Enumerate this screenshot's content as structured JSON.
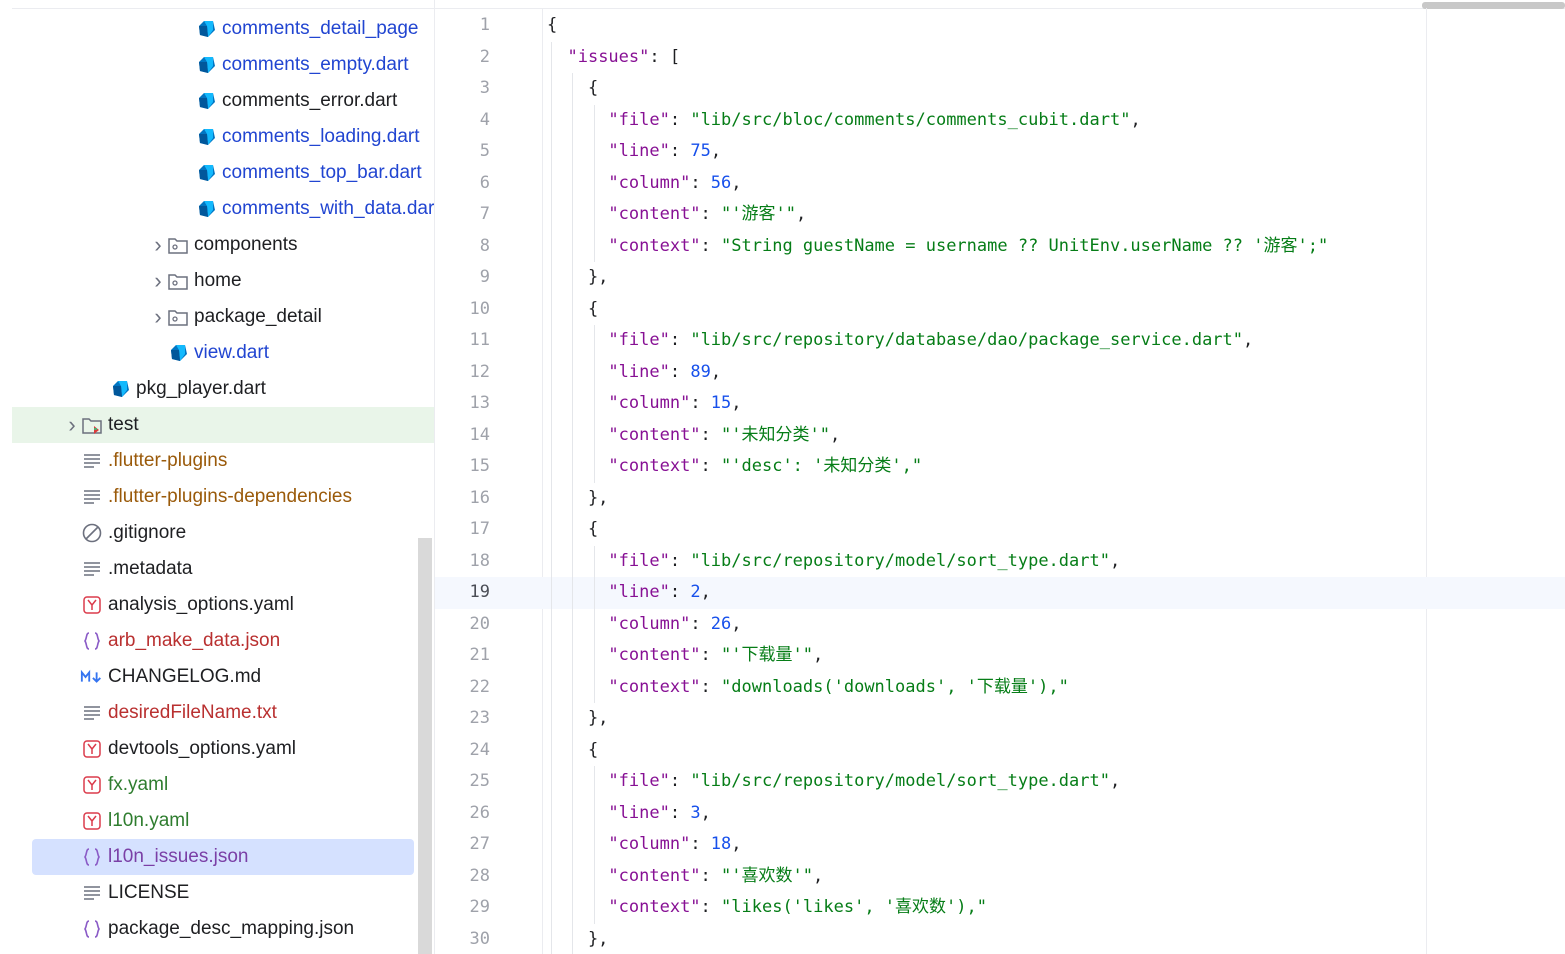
{
  "file_tree": [
    {
      "label": "comments_detail_page",
      "kind": "dart",
      "color": "blue",
      "indent": 208
    },
    {
      "label": "comments_empty.dart",
      "kind": "dart",
      "color": "blue",
      "indent": 208
    },
    {
      "label": "comments_error.dart",
      "kind": "dart",
      "color": "black",
      "indent": 208
    },
    {
      "label": "comments_loading.dart",
      "kind": "dart",
      "color": "blue",
      "indent": 208
    },
    {
      "label": "comments_top_bar.dart",
      "kind": "dart",
      "color": "blue",
      "indent": 208
    },
    {
      "label": "comments_with_data.dart",
      "kind": "dart",
      "color": "blue",
      "indent": 208
    },
    {
      "label": "components",
      "kind": "folder",
      "color": "black",
      "indent": 180,
      "expandable": true
    },
    {
      "label": "home",
      "kind": "folder",
      "color": "black",
      "indent": 180,
      "expandable": true
    },
    {
      "label": "package_detail",
      "kind": "folder",
      "color": "black",
      "indent": 180,
      "expandable": true
    },
    {
      "label": "view.dart",
      "kind": "dart",
      "color": "blue",
      "indent": 180
    },
    {
      "label": "pkg_player.dart",
      "kind": "dart",
      "color": "black",
      "indent": 122
    },
    {
      "label": "test",
      "kind": "test-folder",
      "color": "black",
      "indent": 94,
      "expandable": true,
      "active": true
    },
    {
      "label": ".flutter-plugins",
      "kind": "text",
      "color": "orange",
      "indent": 94
    },
    {
      "label": ".flutter-plugins-dependencies",
      "kind": "text",
      "color": "orange",
      "indent": 94
    },
    {
      "label": ".gitignore",
      "kind": "ignore",
      "color": "black",
      "indent": 94
    },
    {
      "label": ".metadata",
      "kind": "text",
      "color": "black",
      "indent": 94
    },
    {
      "label": "analysis_options.yaml",
      "kind": "yaml",
      "color": "black",
      "indent": 94
    },
    {
      "label": "arb_make_data.json",
      "kind": "json",
      "color": "red",
      "indent": 94
    },
    {
      "label": "CHANGELOG.md",
      "kind": "md",
      "color": "black",
      "indent": 94
    },
    {
      "label": "desiredFileName.txt",
      "kind": "text",
      "color": "red",
      "indent": 94
    },
    {
      "label": "devtools_options.yaml",
      "kind": "yaml",
      "color": "black",
      "indent": 94
    },
    {
      "label": "fx.yaml",
      "kind": "yaml",
      "color": "green",
      "indent": 94
    },
    {
      "label": "l10n.yaml",
      "kind": "yaml",
      "color": "green",
      "indent": 94
    },
    {
      "label": "l10n_issues.json",
      "kind": "json",
      "color": "purple",
      "indent": 94,
      "selected": true
    },
    {
      "label": "LICENSE",
      "kind": "text",
      "color": "black",
      "indent": 94
    },
    {
      "label": "package_desc_mapping.json",
      "kind": "json",
      "color": "black",
      "indent": 94
    }
  ],
  "editor": {
    "current_line": 19,
    "lines": [
      {
        "n": "1",
        "t": [
          [
            "p",
            "{"
          ]
        ]
      },
      {
        "n": "2",
        "t": [
          [
            "p",
            "  "
          ],
          [
            "k",
            "\"issues\""
          ],
          [
            "p",
            ": ["
          ]
        ]
      },
      {
        "n": "3",
        "t": [
          [
            "p",
            "    {"
          ]
        ]
      },
      {
        "n": "4",
        "t": [
          [
            "p",
            "      "
          ],
          [
            "k",
            "\"file\""
          ],
          [
            "p",
            ": "
          ],
          [
            "s",
            "\"lib/src/bloc/comments/comments_cubit.dart\""
          ],
          [
            "p",
            ","
          ]
        ]
      },
      {
        "n": "5",
        "t": [
          [
            "p",
            "      "
          ],
          [
            "k",
            "\"line\""
          ],
          [
            "p",
            ": "
          ],
          [
            "n",
            "75"
          ],
          [
            "p",
            ","
          ]
        ]
      },
      {
        "n": "6",
        "t": [
          [
            "p",
            "      "
          ],
          [
            "k",
            "\"column\""
          ],
          [
            "p",
            ": "
          ],
          [
            "n",
            "56"
          ],
          [
            "p",
            ","
          ]
        ]
      },
      {
        "n": "7",
        "t": [
          [
            "p",
            "      "
          ],
          [
            "k",
            "\"content\""
          ],
          [
            "p",
            ": "
          ],
          [
            "s",
            "\"'游客'\""
          ],
          [
            "p",
            ","
          ]
        ]
      },
      {
        "n": "8",
        "t": [
          [
            "p",
            "      "
          ],
          [
            "k",
            "\"context\""
          ],
          [
            "p",
            ": "
          ],
          [
            "s",
            "\"String guestName = username ?? UnitEnv.userName ?? '游客';\""
          ]
        ]
      },
      {
        "n": "9",
        "t": [
          [
            "p",
            "    },"
          ]
        ]
      },
      {
        "n": "10",
        "t": [
          [
            "p",
            "    {"
          ]
        ]
      },
      {
        "n": "11",
        "t": [
          [
            "p",
            "      "
          ],
          [
            "k",
            "\"file\""
          ],
          [
            "p",
            ": "
          ],
          [
            "s",
            "\"lib/src/repository/database/dao/package_service.dart\""
          ],
          [
            "p",
            ","
          ]
        ]
      },
      {
        "n": "12",
        "t": [
          [
            "p",
            "      "
          ],
          [
            "k",
            "\"line\""
          ],
          [
            "p",
            ": "
          ],
          [
            "n",
            "89"
          ],
          [
            "p",
            ","
          ]
        ]
      },
      {
        "n": "13",
        "t": [
          [
            "p",
            "      "
          ],
          [
            "k",
            "\"column\""
          ],
          [
            "p",
            ": "
          ],
          [
            "n",
            "15"
          ],
          [
            "p",
            ","
          ]
        ]
      },
      {
        "n": "14",
        "t": [
          [
            "p",
            "      "
          ],
          [
            "k",
            "\"content\""
          ],
          [
            "p",
            ": "
          ],
          [
            "s",
            "\"'未知分类'\""
          ],
          [
            "p",
            ","
          ]
        ]
      },
      {
        "n": "15",
        "t": [
          [
            "p",
            "      "
          ],
          [
            "k",
            "\"context\""
          ],
          [
            "p",
            ": "
          ],
          [
            "s",
            "\"'desc': '未知分类',\""
          ]
        ]
      },
      {
        "n": "16",
        "t": [
          [
            "p",
            "    },"
          ]
        ]
      },
      {
        "n": "17",
        "t": [
          [
            "p",
            "    {"
          ]
        ]
      },
      {
        "n": "18",
        "t": [
          [
            "p",
            "      "
          ],
          [
            "k",
            "\"file\""
          ],
          [
            "p",
            ": "
          ],
          [
            "s",
            "\"lib/src/repository/model/sort_type.dart\""
          ],
          [
            "p",
            ","
          ]
        ]
      },
      {
        "n": "19",
        "t": [
          [
            "p",
            "      "
          ],
          [
            "k",
            "\"line\""
          ],
          [
            "p",
            ": "
          ],
          [
            "n",
            "2"
          ],
          [
            "p",
            ","
          ]
        ]
      },
      {
        "n": "20",
        "t": [
          [
            "p",
            "      "
          ],
          [
            "k",
            "\"column\""
          ],
          [
            "p",
            ": "
          ],
          [
            "n",
            "26"
          ],
          [
            "p",
            ","
          ]
        ]
      },
      {
        "n": "21",
        "t": [
          [
            "p",
            "      "
          ],
          [
            "k",
            "\"content\""
          ],
          [
            "p",
            ": "
          ],
          [
            "s",
            "\"'下载量'\""
          ],
          [
            "p",
            ","
          ]
        ]
      },
      {
        "n": "22",
        "t": [
          [
            "p",
            "      "
          ],
          [
            "k",
            "\"context\""
          ],
          [
            "p",
            ": "
          ],
          [
            "s",
            "\"downloads('downloads', '下载量'),\""
          ]
        ]
      },
      {
        "n": "23",
        "t": [
          [
            "p",
            "    },"
          ]
        ]
      },
      {
        "n": "24",
        "t": [
          [
            "p",
            "    {"
          ]
        ]
      },
      {
        "n": "25",
        "t": [
          [
            "p",
            "      "
          ],
          [
            "k",
            "\"file\""
          ],
          [
            "p",
            ": "
          ],
          [
            "s",
            "\"lib/src/repository/model/sort_type.dart\""
          ],
          [
            "p",
            ","
          ]
        ]
      },
      {
        "n": "26",
        "t": [
          [
            "p",
            "      "
          ],
          [
            "k",
            "\"line\""
          ],
          [
            "p",
            ": "
          ],
          [
            "n",
            "3"
          ],
          [
            "p",
            ","
          ]
        ]
      },
      {
        "n": "27",
        "t": [
          [
            "p",
            "      "
          ],
          [
            "k",
            "\"column\""
          ],
          [
            "p",
            ": "
          ],
          [
            "n",
            "18"
          ],
          [
            "p",
            ","
          ]
        ]
      },
      {
        "n": "28",
        "t": [
          [
            "p",
            "      "
          ],
          [
            "k",
            "\"content\""
          ],
          [
            "p",
            ": "
          ],
          [
            "s",
            "\"'喜欢数'\""
          ],
          [
            "p",
            ","
          ]
        ]
      },
      {
        "n": "29",
        "t": [
          [
            "p",
            "      "
          ],
          [
            "k",
            "\"context\""
          ],
          [
            "p",
            ": "
          ],
          [
            "s",
            "\"likes('likes', '喜欢数'),\""
          ]
        ]
      },
      {
        "n": "30",
        "t": [
          [
            "p",
            "    },"
          ]
        ]
      }
    ]
  },
  "colors": {
    "json_key": "#871094",
    "json_string": "#067d17",
    "json_number": "#1750eb",
    "dart_icon": "#0175c2",
    "selection": "#d5e1ff",
    "active_row": "#e9f5e9"
  }
}
